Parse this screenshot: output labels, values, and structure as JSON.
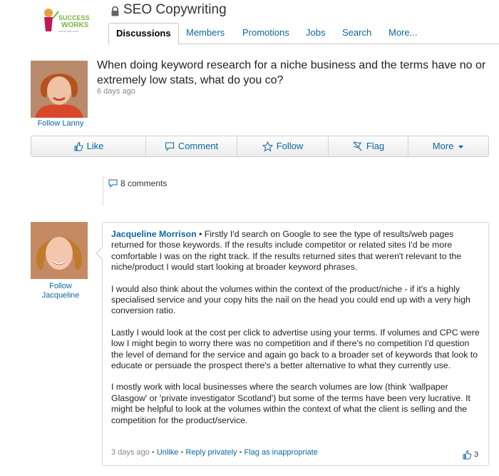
{
  "header": {
    "logo_alt": "Success Works",
    "group_title": "SEO Copywriting",
    "tabs": [
      {
        "label": "Discussions",
        "active": true
      },
      {
        "label": "Members"
      },
      {
        "label": "Promotions"
      },
      {
        "label": "Jobs"
      },
      {
        "label": "Search"
      },
      {
        "label": "More..."
      }
    ]
  },
  "question": {
    "title": "When doing keyword research for a niche business and the terms have no or extremely low stats, what do you co?",
    "time": "6 days ago",
    "follow_label": "Follow Lanny"
  },
  "actions": [
    {
      "label": "Like",
      "icon": "thumbs-up-icon"
    },
    {
      "label": "Comment",
      "icon": "speech-bubble-icon"
    },
    {
      "label": "Follow",
      "icon": "star-icon"
    },
    {
      "label": "Flag",
      "icon": "flag-icon"
    },
    {
      "label": "More",
      "icon": "caret-down-icon"
    }
  ],
  "comments_count": "8 comments",
  "comment": {
    "author": "Jacqueline Morrison",
    "separator": " • ",
    "paragraphs": [
      "Firstly I'd search on Google to see the type of results/web pages returned for those keywords. If the results include competitor or related sites I'd be more comfortable I was on the right track. If the results returned sites that weren't relevant to the niche/product I would start looking at broader keyword phrases.",
      "I would also think about the volumes within the context of the product/niche - if it's a highly specialised service and your copy hits the nail on the head you could end up with a very high conversion ratio.",
      "Lastly I would look at the cost per click to advertise using your terms. If volumes and CPC were low I might begin to worry there was no competition and if there's no competition I'd question the level of demand for the service and again go back to a broader set of keywords that look to educate or persuade the prospect there's a better alternative to what they currently use.",
      "I mostly work with local businesses where the search volumes are low (think 'wallpaper Glasgow' or 'private investigator Scotland') but some of the terms have been very lucrative. It might be helpful to look at the volumes within the context of what the client is selling and the competition for the product/service."
    ],
    "follow_label_line1": "Follow",
    "follow_label_line2": "Jacqueline",
    "time": "3 days ago",
    "unlike_label": "Unlike",
    "reply_label": "Reply privately",
    "flag_label": "Flag as inappropriate",
    "like_count": "3"
  },
  "colors": {
    "link": "#0a67a3",
    "border": "#d6d6d6"
  }
}
